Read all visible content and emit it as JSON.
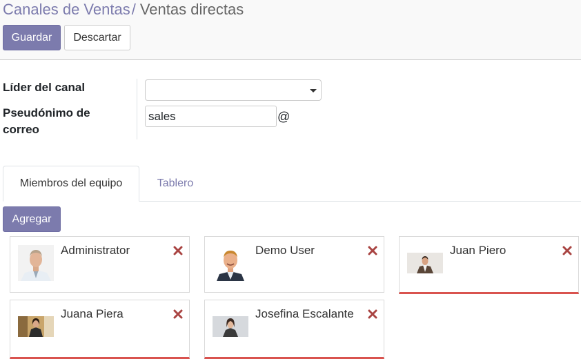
{
  "breadcrumb": {
    "parent": "Canales de Ventas",
    "separator": "/",
    "current": "Ventas directas"
  },
  "buttons": {
    "save": "Guardar",
    "discard": "Descartar",
    "add": "Agregar"
  },
  "form": {
    "leader_label": "Líder del canal",
    "leader_value": "",
    "alias_label_line1": "Pseudónimo de",
    "alias_label_line2": "correo",
    "alias_value": "sales",
    "alias_suffix": "@"
  },
  "tabs": {
    "members": "Miembros del equipo",
    "dashboard": "Tablero"
  },
  "members": [
    {
      "name": "Administrator",
      "photo": "administrator-avatar",
      "warning": false
    },
    {
      "name": "Demo User",
      "photo": "demo-user-avatar",
      "warning": false
    },
    {
      "name": "Juan Piero",
      "photo": "juan-piero-avatar",
      "warning": true
    },
    {
      "name": "Juana Piera",
      "photo": "juana-piera-avatar",
      "warning": true
    },
    {
      "name": "Josefina Escalante",
      "photo": "josefina-escalante-avatar",
      "warning": true
    }
  ],
  "icons": {
    "remove": "close-icon",
    "dropdown": "caret-down-icon"
  },
  "colors": {
    "primary": "#7c7bad",
    "remove": "#a94442",
    "warning_border": "#d9534f"
  }
}
